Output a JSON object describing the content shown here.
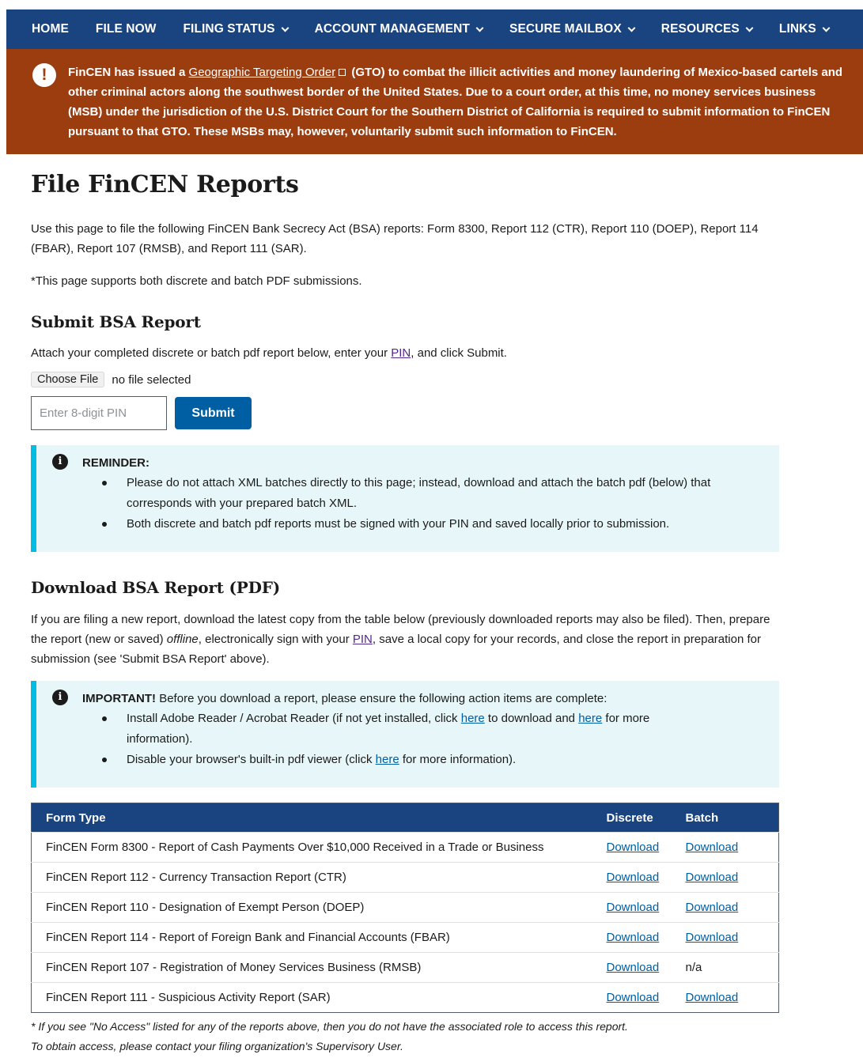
{
  "nav": {
    "items": [
      {
        "label": "HOME",
        "dropdown": false
      },
      {
        "label": "FILE NOW",
        "dropdown": false
      },
      {
        "label": "FILING STATUS",
        "dropdown": true
      },
      {
        "label": "ACCOUNT MANAGEMENT",
        "dropdown": true
      },
      {
        "label": "SECURE MAILBOX",
        "dropdown": true
      },
      {
        "label": "RESOURCES",
        "dropdown": true
      },
      {
        "label": "LINKS",
        "dropdown": true
      }
    ]
  },
  "alert": {
    "icon": "exclamation-circle-icon",
    "text_before": "FinCEN has issued a ",
    "link": "Geographic Targeting Order",
    "text_after": " (GTO) to combat the illicit activities and money laundering of Mexico-based cartels and other criminal actors along the southwest border of the United States. Due to a court order, at this time, no money services business (MSB) under the jurisdiction of the U.S. District Court for the Southern District of California is required to submit information to FinCEN pursuant to that GTO. These MSBs may, however, voluntarily submit such information to FinCEN."
  },
  "page": {
    "title": "File FinCEN Reports",
    "intro": "Use this page to file the following FinCEN Bank Secrecy Act (BSA) reports: Form 8300, Report 112 (CTR), Report 110 (DOEP), Report 114 (FBAR), Report 107 (RMSB), and Report 111 (SAR).",
    "note": "*This page supports both discrete and batch PDF submissions."
  },
  "submit": {
    "heading": "Submit BSA Report",
    "instr_before": "Attach your completed discrete or batch pdf report below, enter your ",
    "instr_link": "PIN",
    "instr_after": ", and click Submit.",
    "choose_label": "Choose File",
    "file_status": "no file selected",
    "pin_placeholder": "Enter 8-digit PIN",
    "submit_label": "Submit"
  },
  "reminder": {
    "title": "REMINDER:",
    "items": [
      "Please do not attach XML batches directly to this page; instead, download and attach the batch pdf (below) that corresponds with your prepared batch XML.",
      "Both discrete and batch pdf reports must be signed with your PIN and saved locally prior to submission."
    ]
  },
  "download": {
    "heading": "Download BSA Report (PDF)",
    "p1": "If you are filing a new report, download the latest copy from the table below (previously downloaded reports may also be filed).",
    "p2_a": "Then, prepare the report (new or saved) ",
    "p2_em": "offline",
    "p2_b": ", electronically sign with your ",
    "p2_link": "PIN",
    "p2_c": ", save a local copy for your records, and close the report in preparation for submission (see 'Submit BSA Report' above)."
  },
  "important": {
    "title": "IMPORTANT!",
    "lead": " Before you download a report, please ensure the following action items are complete:",
    "item1_a": "Install Adobe Reader / Acrobat Reader (if not yet installed, click ",
    "item1_link1": "here",
    "item1_b": " to download and ",
    "item1_link2": "here",
    "item1_c": " for more information).",
    "item2_a": "Disable your browser's built-in pdf viewer (click ",
    "item2_link": "here",
    "item2_b": " for more information)."
  },
  "table": {
    "headers": [
      "Form Type",
      "Discrete",
      "Batch"
    ],
    "rows": [
      {
        "form": "FinCEN Form 8300 - Report of Cash Payments Over $10,000 Received in a Trade or Business",
        "discrete": "Download",
        "batch": "Download"
      },
      {
        "form": "FinCEN Report 112 - Currency Transaction Report (CTR)",
        "discrete": "Download",
        "batch": "Download"
      },
      {
        "form": "FinCEN Report 110 - Designation of Exempt Person (DOEP)",
        "discrete": "Download",
        "batch": "Download"
      },
      {
        "form": "FinCEN Report 114 - Report of Foreign Bank and Financial Accounts (FBAR)",
        "discrete": "Download",
        "batch": "Download"
      },
      {
        "form": "FinCEN Report 107 - Registration of Money Services Business (RMSB)",
        "discrete": "Download",
        "batch": "n/a"
      },
      {
        "form": "FinCEN Report 111 - Suspicious Activity Report (SAR)",
        "discrete": "Download",
        "batch": "Download"
      }
    ]
  },
  "footnote": {
    "line1": "* If you see \"No Access\" listed for any of the reports above, then you do not have the associated role to access this report.",
    "line2": "To obtain access, please contact your filing organization's Supervisory User."
  }
}
